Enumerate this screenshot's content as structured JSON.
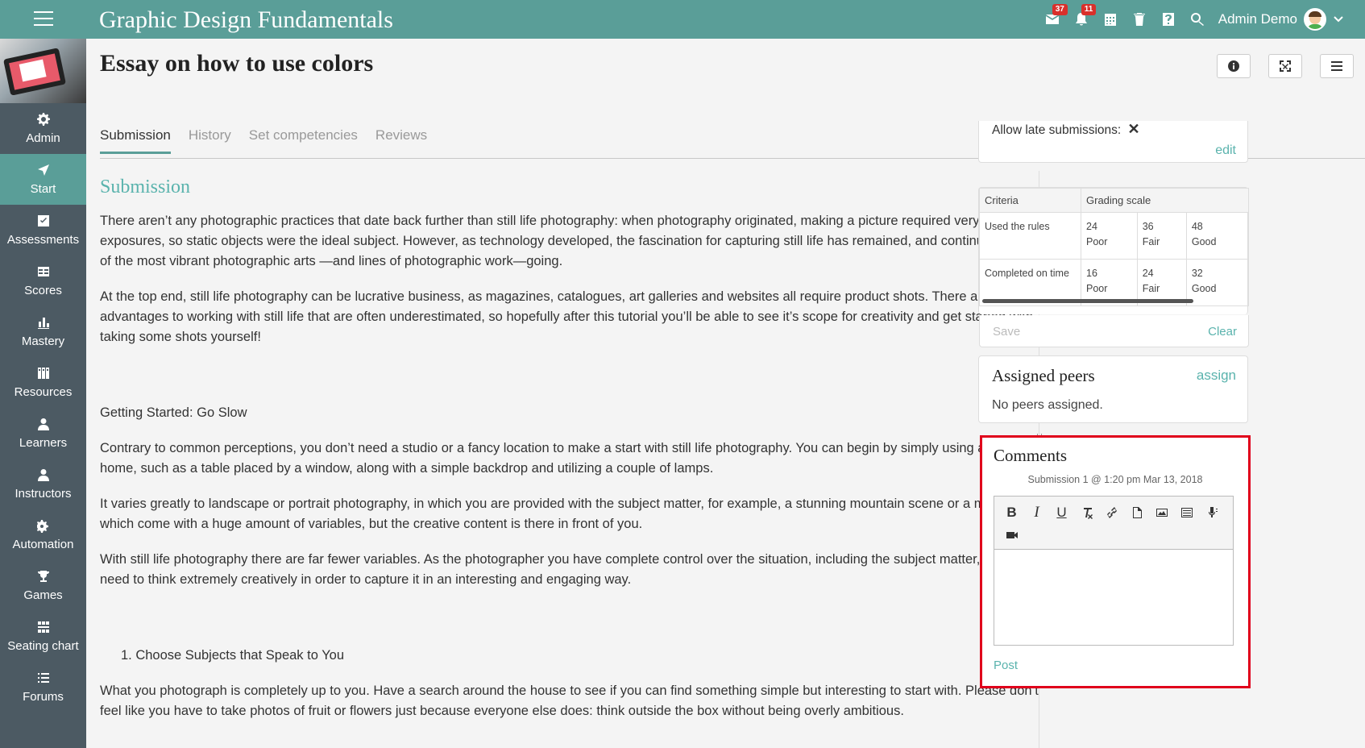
{
  "app": {
    "title": "Graphic Design Fundamentals",
    "user_name": "Admin Demo",
    "messages_badge": "37",
    "notifications_badge": "11",
    "accent_color": "#5a9e98",
    "sidebar_color": "#4c5a63",
    "badge_color": "#d9302b"
  },
  "sidebar": {
    "items": [
      {
        "label": "Admin",
        "icon": "gear-icon"
      },
      {
        "label": "Start",
        "icon": "paper-plane-icon",
        "active": true
      },
      {
        "label": "Assessments",
        "icon": "checkbox-icon"
      },
      {
        "label": "Scores",
        "icon": "table-icon"
      },
      {
        "label": "Mastery",
        "icon": "bar-chart-icon"
      },
      {
        "label": "Resources",
        "icon": "library-icon"
      },
      {
        "label": "Learners",
        "icon": "user-icon"
      },
      {
        "label": "Instructors",
        "icon": "user-icon"
      },
      {
        "label": "Automation",
        "icon": "gears-icon"
      },
      {
        "label": "Games",
        "icon": "trophy-icon"
      },
      {
        "label": "Seating chart",
        "icon": "seating-icon"
      },
      {
        "label": "Forums",
        "icon": "list-icon"
      }
    ]
  },
  "page": {
    "title": "Essay on how to use colors",
    "tabs": [
      "Submission",
      "History",
      "Set competencies",
      "Reviews"
    ],
    "active_tab": "Submission"
  },
  "submission": {
    "heading": "Submission",
    "p1": "There aren’t any photographic practices that date back further than still life photography: when photography originated, making a picture required very long exposures, so static objects were the ideal subject. However, as technology developed, the fascination for capturing still life has remained, and continues as one of the most vibrant photographic arts —and lines of photographic work—going.",
    "p2": "At the top end, still life photography can be lucrative business, as magazines, catalogues, art galleries and websites all require product shots. There are many advantages to working with still life that are often underestimated, so hopefully after this tutorial you’ll be able to see it’s scope for creativity and get started with taking some shots yourself!",
    "h_getting_started": "Getting Started: Go Slow",
    "p3": "Contrary to common perceptions, you don’t need a studio or a fancy location to make a start with still life photography. You can begin by simply using a space at home, such as a table placed by a window, along with a simple backdrop and utilizing a couple of lamps.",
    "p4": "It varies greatly to landscape or portrait photography, in which you are provided with the subject matter, for example, a stunning mountain scene or a model, which come with a huge amount of variables, but the creative content is there in front of you.",
    "p5": "With still life photography there are far fewer variables. As the photographer you have complete control over the situation, including the subject matter, but you need to think extremely creatively in order to capture it in an interesting and engaging way.",
    "list_item_1": "1. Choose Subjects that Speak to You",
    "p6": "What you photograph is completely up to you. Have a search around the house to see if you can find something simple but interesting to start with. Please don’t feel like you have to take photos of fruit or flowers just because everyone else does: think outside the box without being overly ambitious."
  },
  "settings_card": {
    "late_label": "Allow late submissions:",
    "late_value": "✕",
    "edit_label": "edit"
  },
  "rubric": {
    "headers": [
      "Criteria",
      "Grading scale"
    ],
    "rows": [
      {
        "criteria": "Used the rules",
        "levels": [
          {
            "points": "24",
            "label": "Poor"
          },
          {
            "points": "36",
            "label": "Fair"
          },
          {
            "points": "48",
            "label": "Good"
          }
        ]
      },
      {
        "criteria": "Completed on time",
        "levels": [
          {
            "points": "16",
            "label": "Poor"
          },
          {
            "points": "24",
            "label": "Fair"
          },
          {
            "points": "32",
            "label": "Good"
          }
        ]
      }
    ],
    "save_label": "Save",
    "clear_label": "Clear"
  },
  "peers": {
    "title": "Assigned peers",
    "assign_label": "assign",
    "empty_text": "No peers assigned."
  },
  "comments": {
    "title": "Comments",
    "meta": "Submission 1 @ 1:20 pm Mar 13, 2018",
    "toolbar": [
      "bold-icon",
      "italic-icon",
      "underline-icon",
      "clear-format-icon",
      "link-icon",
      "file-icon",
      "image-icon",
      "media-icon",
      "microphone-icon",
      "video-icon"
    ],
    "body_value": "",
    "post_label": "Post",
    "highlight_color": "#e0001b"
  }
}
